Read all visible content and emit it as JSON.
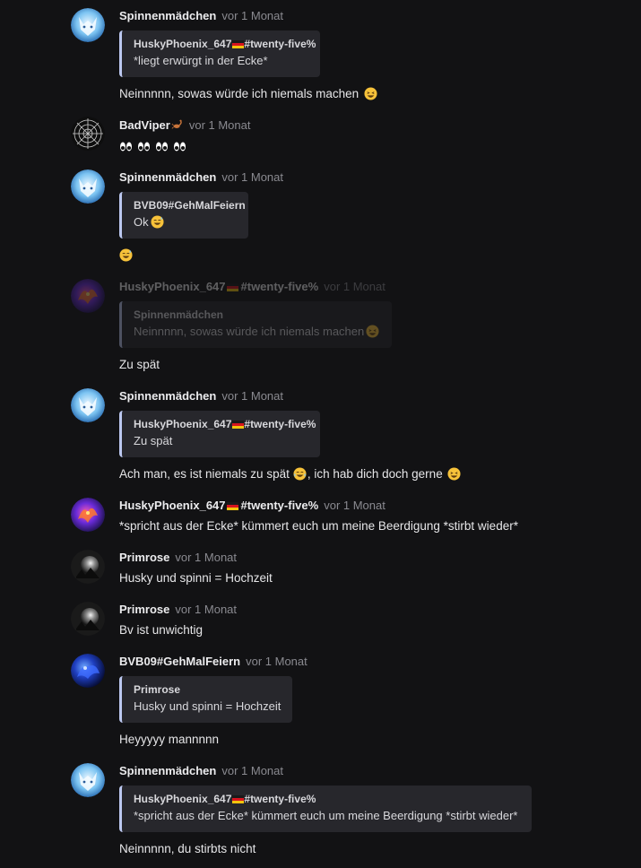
{
  "messages": [
    {
      "author": "Spinnenmädchen",
      "time": "vor 1 Monat",
      "quote": {
        "author": "HuskyPhoenix_647",
        "tag": "#twenty-five%",
        "text": "*liegt erwürgt in der Ecke*"
      },
      "text": "Neinnnnn, sowas würde ich niemals machen",
      "avatar": "wolf-avatar"
    },
    {
      "author": "BadViper",
      "time": "vor 1 Monat",
      "text": "",
      "emojis": [
        "eyes",
        "eyes",
        "eyes",
        "eyes"
      ],
      "avatar": "web-avatar"
    },
    {
      "author": "Spinnenmädchen",
      "time": "vor 1 Monat",
      "quote": {
        "author": "BVB09#GehMalFeiern",
        "text": "Ok"
      },
      "text": "",
      "avatar": "wolf-avatar"
    },
    {
      "author": "HuskyPhoenix_647",
      "tag": "#twenty-five%",
      "time": "vor 1 Monat",
      "quote": {
        "author": "Spinnenmädchen",
        "text": "Neinnnnn, sowas würde ich niemals machen"
      },
      "text": "Zu spät",
      "avatar": "phoenix-avatar",
      "faded": true
    },
    {
      "author": "Spinnenmädchen",
      "time": "vor 1 Monat",
      "quote": {
        "author": "HuskyPhoenix_647",
        "tag": "#twenty-five%",
        "text": "Zu spät"
      },
      "text_parts": [
        "Ach man, es ist niemals zu spät",
        ", ich hab dich doch gerne"
      ],
      "avatar": "wolf-avatar"
    },
    {
      "author": "HuskyPhoenix_647",
      "tag": "#twenty-five%",
      "time": "vor 1 Monat",
      "text": "*spricht aus der Ecke* kümmert euch um meine Beerdigung *stirbt wieder*",
      "avatar": "phoenix-avatar"
    },
    {
      "author": "Primrose",
      "time": "vor 1 Monat",
      "text": "Husky und spinni = Hochzeit",
      "avatar": "moon-avatar"
    },
    {
      "author": "Primrose",
      "time": "vor 1 Monat",
      "text": "Bv ist unwichtig",
      "avatar": "moon-avatar"
    },
    {
      "author": "BVB09#GehMalFeiern",
      "time": "vor 1 Monat",
      "quote": {
        "author": "Primrose",
        "text": "Husky und spinni = Hochzeit"
      },
      "text": "Heyyyyy mannnnn",
      "avatar": "blue-avatar"
    },
    {
      "author": "Spinnenmädchen",
      "time": "vor 1 Monat",
      "quote": {
        "author": "HuskyPhoenix_647",
        "tag": "#twenty-five%",
        "text": "*spricht aus der Ecke* kümmert euch um meine Beerdigung *stirbt wieder*"
      },
      "text": "Neinnnnn, du stirbts nicht",
      "avatar": "wolf-avatar"
    }
  ]
}
